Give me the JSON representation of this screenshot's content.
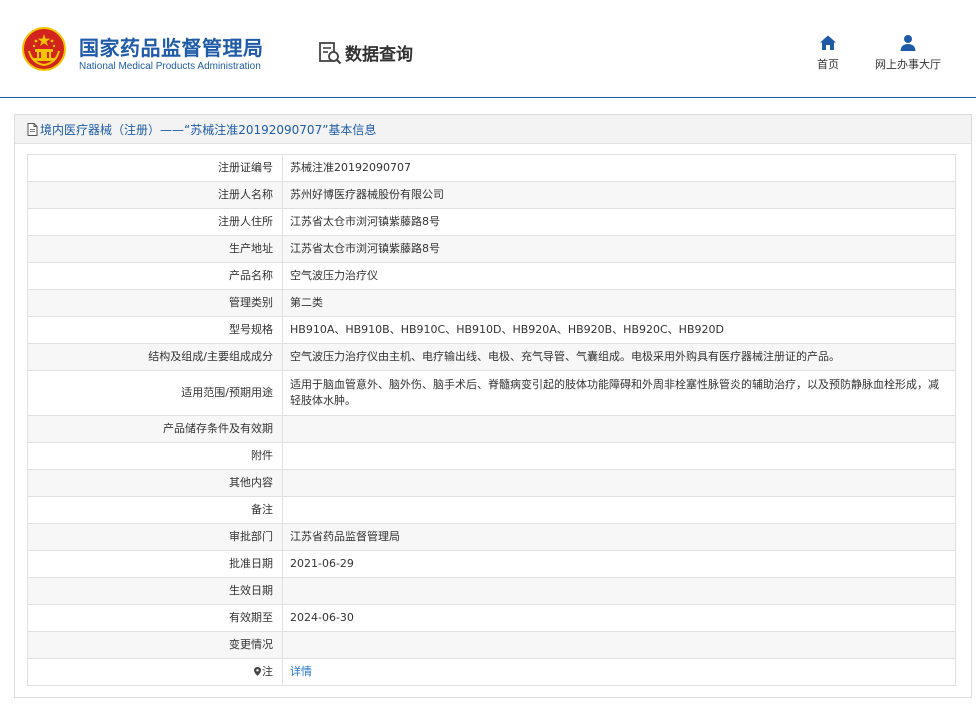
{
  "header": {
    "org_name_cn": "国家药品监督管理局",
    "org_name_en": "National Medical Products Administration",
    "query_title": "数据查询",
    "nav": [
      {
        "label": "首页",
        "icon": "home-icon"
      },
      {
        "label": "网上办事大厅",
        "icon": "user-icon"
      }
    ]
  },
  "panel": {
    "title": "境内医疗器械（注册）——“苏械注准20192090707”基本信息"
  },
  "rows": [
    {
      "key": "注册证编号",
      "value": "苏械注准20192090707"
    },
    {
      "key": "注册人名称",
      "value": "苏州好博医疗器械股份有限公司"
    },
    {
      "key": "注册人住所",
      "value": "江苏省太仓市浏河镇紫藤路8号"
    },
    {
      "key": "生产地址",
      "value": "江苏省太仓市浏河镇紫藤路8号"
    },
    {
      "key": "产品名称",
      "value": "空气波压力治疗仪"
    },
    {
      "key": "管理类别",
      "value": "第二类"
    },
    {
      "key": "型号规格",
      "value": "HB910A、HB910B、HB910C、HB910D、HB920A、HB920B、HB920C、HB920D"
    },
    {
      "key": "结构及组成/主要组成成分",
      "value": "空气波压力治疗仪由主机、电疗输出线、电极、充气导管、气囊组成。电极采用外购具有医疗器械注册证的产品。"
    },
    {
      "key": "适用范围/预期用途",
      "value": "适用于脑血管意外、脑外伤、脑手术后、脊髓病变引起的肢体功能障碍和外周非栓塞性脉管炎的辅助治疗，以及预防静脉血栓形成，减轻肢体水肿。"
    },
    {
      "key": "产品储存条件及有效期",
      "value": ""
    },
    {
      "key": "附件",
      "value": ""
    },
    {
      "key": "其他内容",
      "value": ""
    },
    {
      "key": "备注",
      "value": ""
    },
    {
      "key": "审批部门",
      "value": "江苏省药品监督管理局"
    },
    {
      "key": "批准日期",
      "value": "2021-06-29"
    },
    {
      "key": "生效日期",
      "value": ""
    },
    {
      "key": "有效期至",
      "value": "2024-06-30"
    },
    {
      "key": "变更情况",
      "value": ""
    },
    {
      "key": "注",
      "value": "详情"
    }
  ],
  "colors": {
    "brand_blue": "#1f5ba7",
    "emblem_red": "#d2231c",
    "emblem_gold": "#f2c500",
    "link_blue": "#1f73c9"
  }
}
